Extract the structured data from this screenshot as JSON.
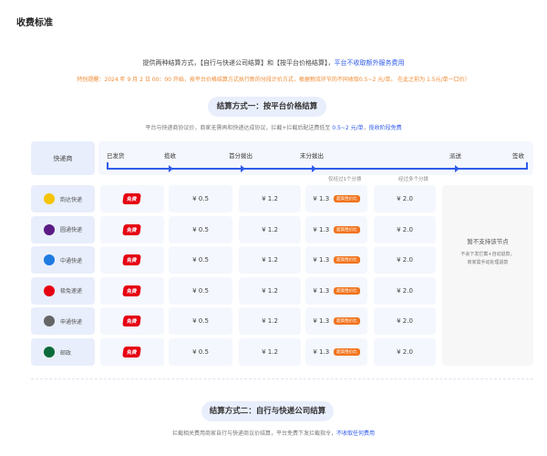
{
  "page_title": "收费标准",
  "intro": {
    "text": "提供两种结算方式，【自行与快递公司结算】和【按平台价格结算】，",
    "highlight": "平台不收取额外服务费用"
  },
  "notice": "特别提醒：2024 年 9 月 2 日 00：00 开始，按平台价格结算方式执行新的分段计价方式，根据物流环节的不同收取0.5~2 元/单。 在此之前为 1.5元/单一口价）",
  "method_one": {
    "title": "结算方式一：按平台价格结算",
    "desc": "平台与快递商协议价，商家无需再和快递达成协议，拦截+拦截后配送费低至 ",
    "desc_price": "0.5~2 元/单",
    "desc_sep": "，",
    "desc_highlight": "揽收阶段免费"
  },
  "table": {
    "carrier_header": "快递商",
    "timeline": [
      "已发货",
      "揽收",
      "首分拨出",
      "末分拨出",
      "派送",
      "签收"
    ],
    "col_notes": [
      "仅经过1个分拨",
      "经过多个分拨"
    ],
    "free_label": "免费",
    "tag_label": "超高性价比",
    "prices": [
      "¥ 0.5",
      "¥ 1.2",
      "¥ 1.3",
      "¥ 2.0"
    ],
    "carriers": [
      {
        "name": "韵达快递",
        "color": "#f5c400"
      },
      {
        "name": "圆通快递",
        "color": "#5b1a84"
      },
      {
        "name": "中通快递",
        "color": "#1e7be0"
      },
      {
        "name": "极兔速递",
        "color": "#e60012"
      },
      {
        "name": "申通快递",
        "color": "#666666"
      },
      {
        "name": "邮政",
        "color": "#0b6b3a"
      }
    ],
    "unsupported_title": "暂不支持该节点",
    "unsupported_desc1": "不会下发拦截+自动退款，",
    "unsupported_desc2": "商家需手动处理退款"
  },
  "method_two": {
    "title": "结算方式二：自行与快递公司结算",
    "desc": "拦截相关费用商家自行与快递商议价结算，平台免费下发拦截指令，",
    "desc_highlight": "不收取任何费用"
  },
  "colors": {
    "accent": "#2f5bea",
    "warning": "#f08a33",
    "free": "#e60012",
    "tag": "#f2741d"
  }
}
